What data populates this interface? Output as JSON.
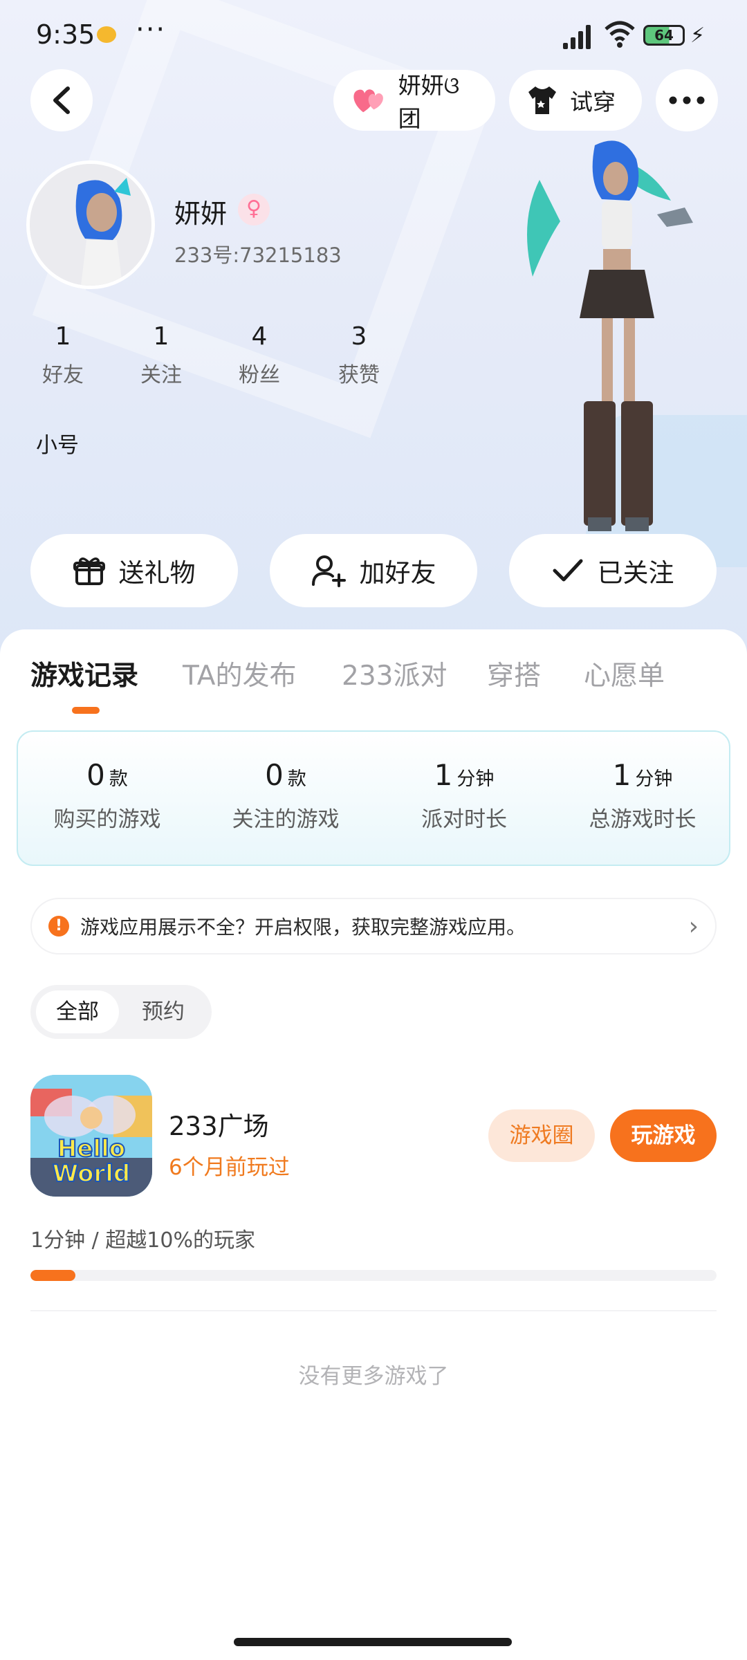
{
  "status_bar": {
    "time": "9:35",
    "more": "···",
    "battery": "64",
    "icons": [
      "weibo-icon",
      "signal-icon",
      "wifi-icon",
      "battery-icon",
      "charging-icon"
    ]
  },
  "header": {
    "back_icon": "chevron-left-icon",
    "fan_group_label": "妍妍ଓ团",
    "try_on_label": "试穿",
    "more_icon": "more-icon"
  },
  "profile": {
    "username": "妍妍",
    "gender_symbol": "♀",
    "user_id": "233号:73215183",
    "bio": "小号",
    "stats": [
      {
        "value": "1",
        "label": "好友"
      },
      {
        "value": "1",
        "label": "关注"
      },
      {
        "value": "4",
        "label": "粉丝"
      },
      {
        "value": "3",
        "label": "获赞"
      }
    ]
  },
  "actions": {
    "gift_label": "送礼物",
    "add_friend_label": "加好友",
    "following_label": "已关注"
  },
  "tabs": [
    "游戏记录",
    "TA的发布",
    "233派对",
    "穿搭",
    "心愿单"
  ],
  "summary": [
    {
      "value": "0",
      "unit": "款",
      "label": "购买的游戏"
    },
    {
      "value": "0",
      "unit": "款",
      "label": "关注的游戏"
    },
    {
      "value": "1",
      "unit": "分钟",
      "label": "派对时长"
    },
    {
      "value": "1",
      "unit": "分钟",
      "label": "总游戏时长"
    }
  ],
  "notice": {
    "icon": "!",
    "text": "游戏应用展示不全？开启权限，获取完整游戏应用。"
  },
  "filter": {
    "all": "全部",
    "reserved": "预约"
  },
  "game": {
    "name": "233广场",
    "last_played": "6个月前玩过",
    "icon_text_1": "Hello",
    "icon_text_2": "World",
    "circle_label": "游戏圈",
    "play_label": "玩游戏",
    "playtime": "1分钟 / 超越10%的玩家",
    "progress_fraction": 0.066
  },
  "no_more": "没有更多游戏了",
  "colors": {
    "accent": "#f7721d",
    "accent_soft": "#fde7d9",
    "summary_border": "#c4ecf2",
    "hero_bg": "#e6ebf8"
  }
}
